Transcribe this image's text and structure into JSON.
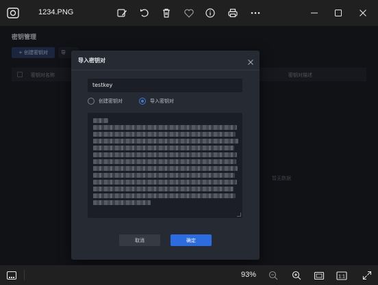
{
  "viewer": {
    "filename": "1234.PNG",
    "zoom": "93%",
    "toolbar_icons": [
      "edit-image-icon",
      "rotate-icon",
      "delete-icon",
      "favorite-icon",
      "info-icon",
      "print-icon",
      "more-icon"
    ],
    "window_controls": [
      "minimize-icon",
      "maximize-icon",
      "close-icon"
    ],
    "status_icons": [
      "filmstrip-icon",
      "zoom-out-icon",
      "zoom-in-icon",
      "fit-window-icon",
      "actual-size-icon",
      "fullscreen-icon"
    ],
    "actual_size_label": "1:1"
  },
  "webapp": {
    "page_title": "密钥管理",
    "create_button": "+ 创建密钥对",
    "import_button": "导",
    "table": {
      "col_name": "密钥对名称",
      "col_time": "密钥对描述"
    },
    "empty_text": "暂无数据"
  },
  "dialog": {
    "title": "导入密钥对",
    "name_value": "testkey",
    "radio_options": [
      {
        "label": "创建密钥对",
        "selected": false
      },
      {
        "label": "导入密钥对",
        "selected": true
      }
    ],
    "cancel_label": "取消",
    "ok_label": "确定"
  },
  "colors": {
    "accent": "#2d6be0",
    "dialog_bg": "#262a33",
    "input_bg": "#1b1e26"
  }
}
